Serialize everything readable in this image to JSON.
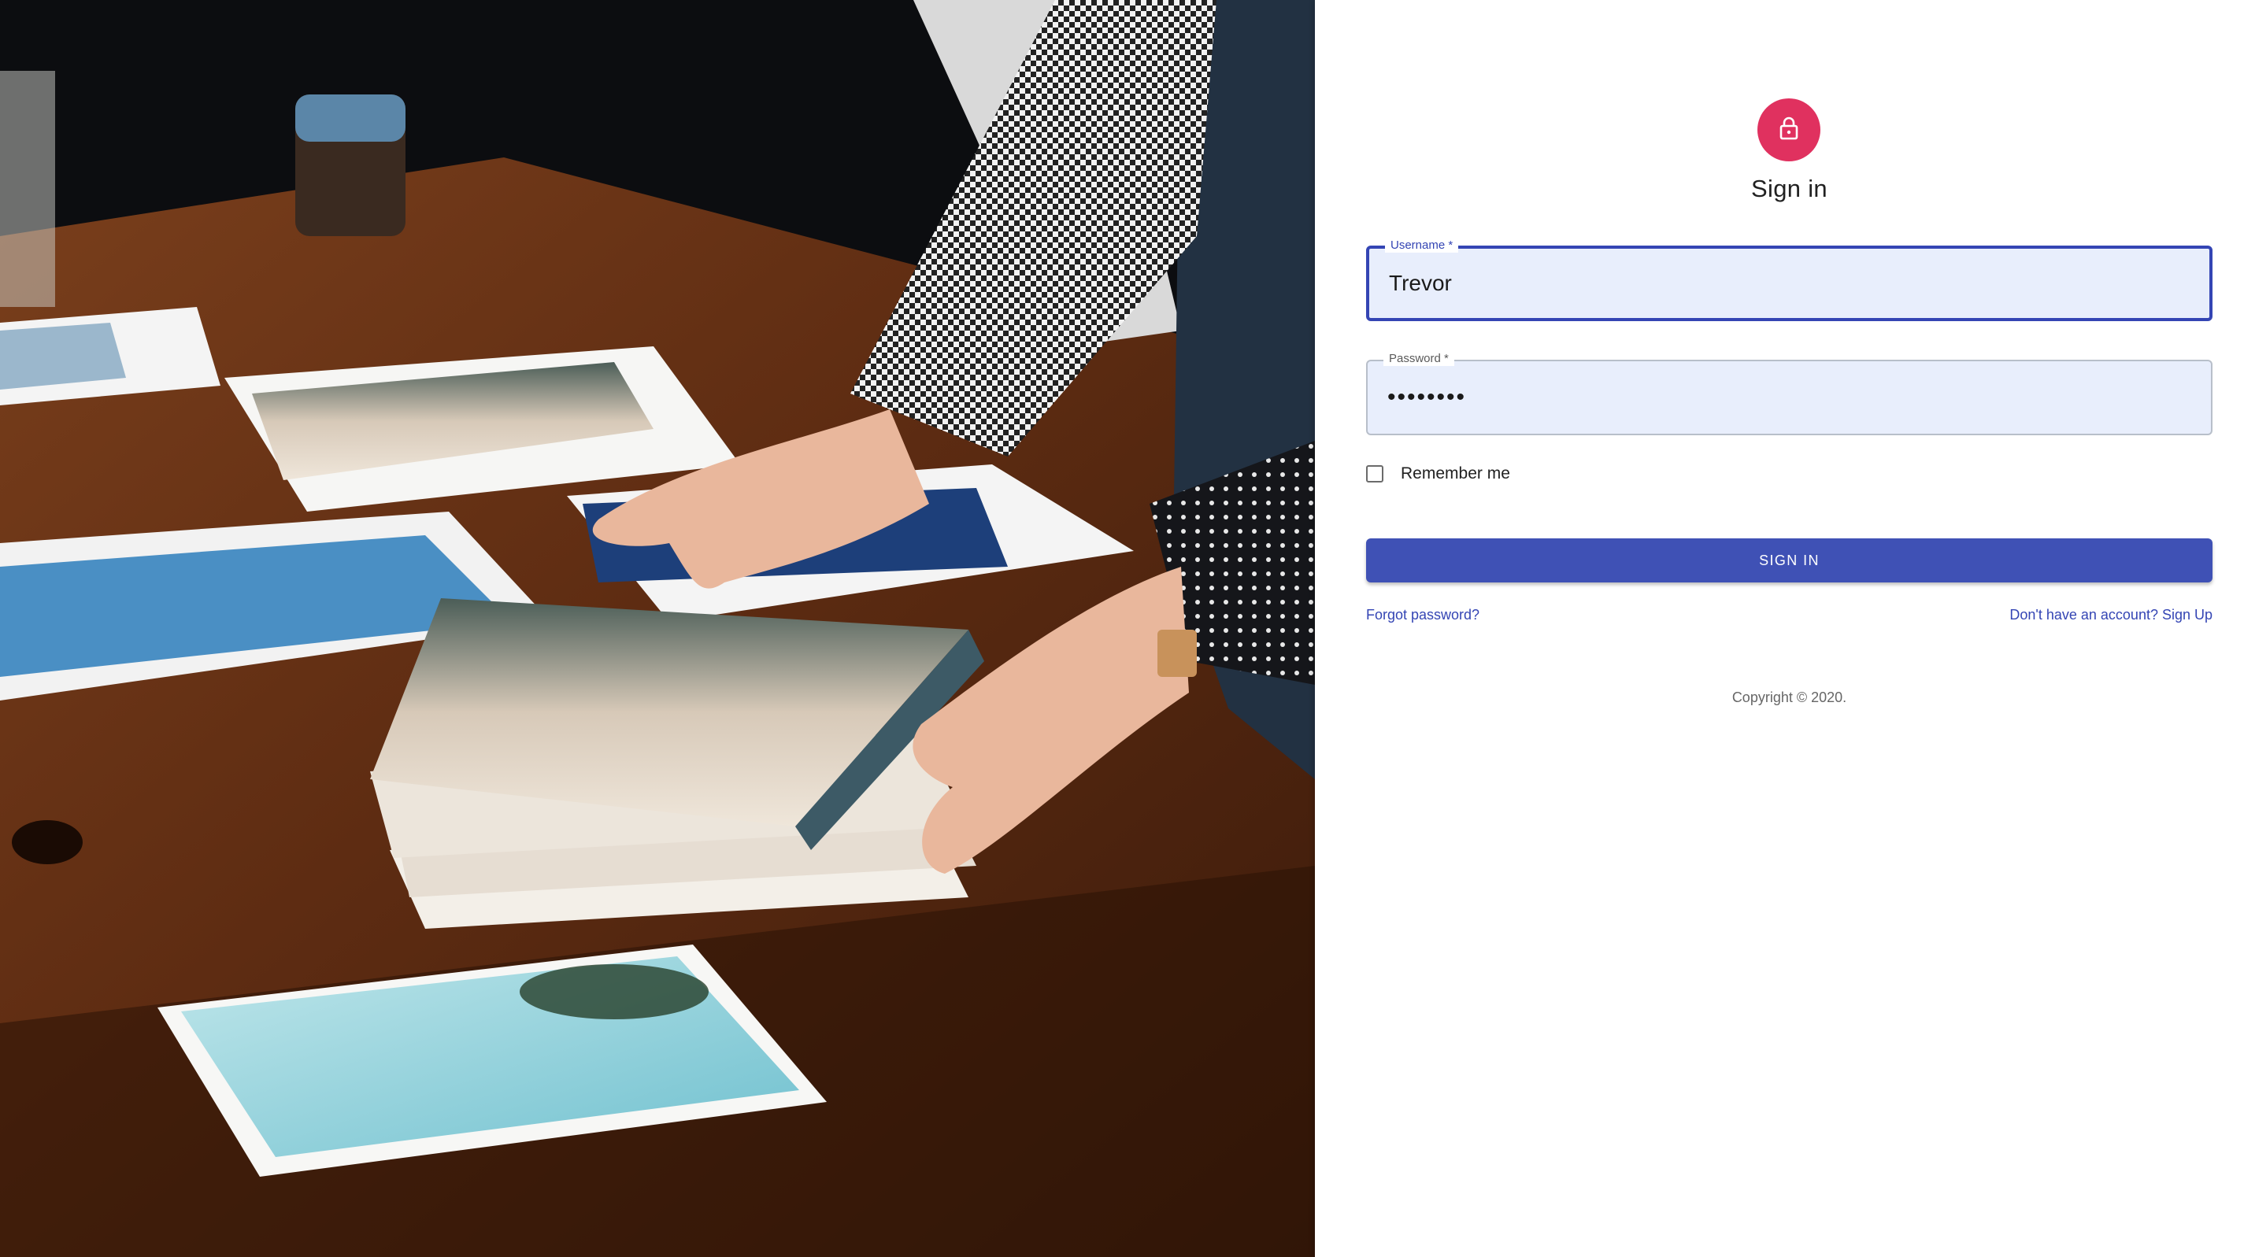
{
  "signin": {
    "title": "Sign in",
    "icon": "lock-icon",
    "accent_color": "#e0315f",
    "primary_color": "#3f51b5"
  },
  "form": {
    "username": {
      "label": "Username *",
      "value": "Trevor"
    },
    "password": {
      "label": "Password *",
      "value": "••••••••"
    },
    "remember_label": "Remember me",
    "remember_checked": false,
    "submit_label": "SIGN IN"
  },
  "links": {
    "forgot_password": "Forgot password?",
    "sign_up": "Don't have an account? Sign Up"
  },
  "footer": {
    "copyright": "Copyright © 2020."
  }
}
